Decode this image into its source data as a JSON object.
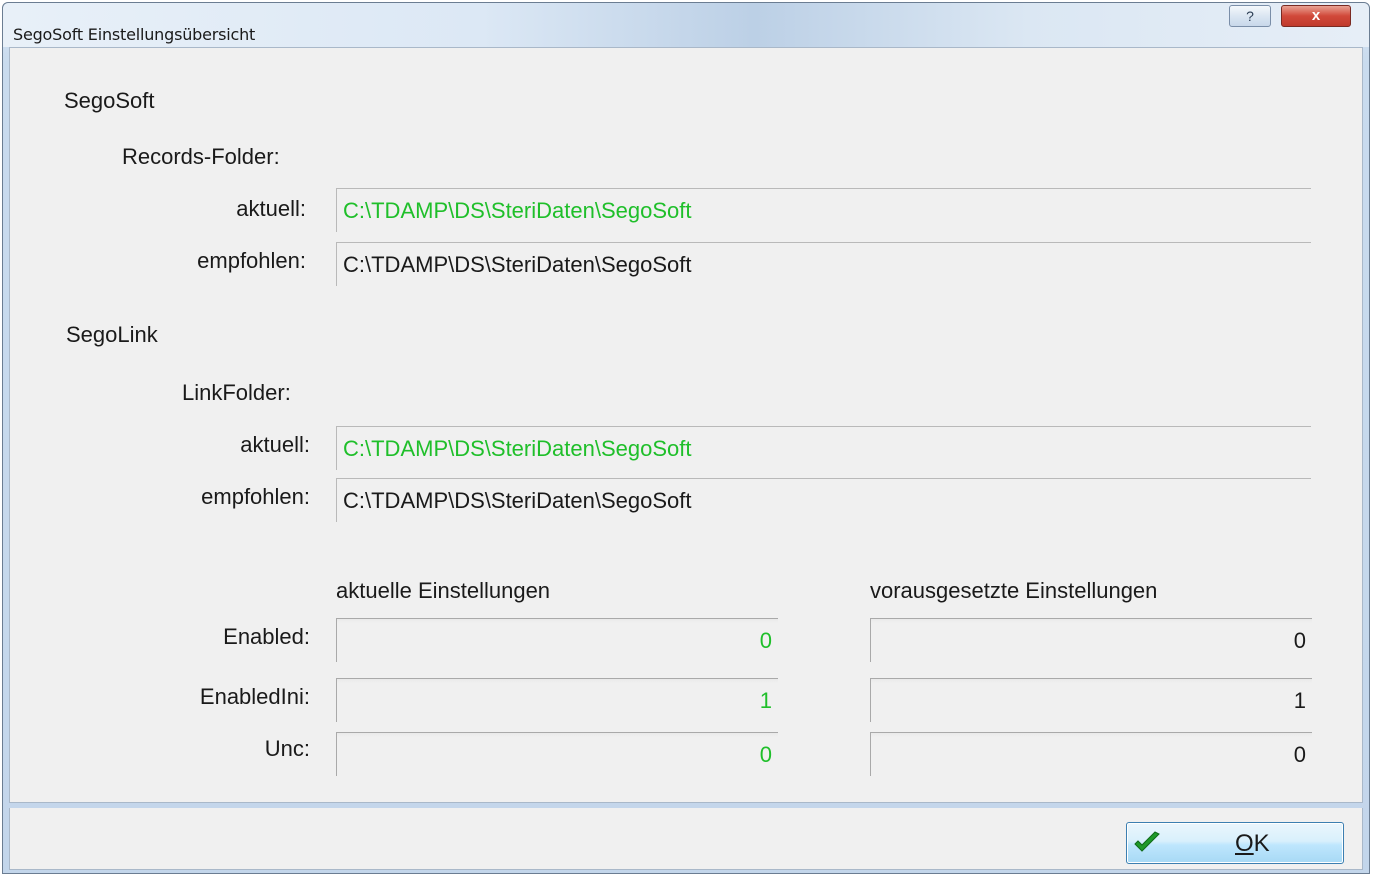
{
  "window": {
    "title": "SegoSoft Einstellungsübersicht",
    "help_glyph": "?",
    "close_glyph": "x"
  },
  "segosoft": {
    "heading": "SegoSoft",
    "records_folder_label": "Records-Folder:",
    "aktuell_label": "aktuell:",
    "aktuell_value": "C:\\TDAMP\\DS\\SteriDaten\\SegoSoft",
    "empfohlen_label": "empfohlen:",
    "empfohlen_value": "C:\\TDAMP\\DS\\SteriDaten\\SegoSoft"
  },
  "segolink": {
    "heading": "SegoLink",
    "link_folder_label": "LinkFolder:",
    "aktuell_label": "aktuell:",
    "aktuell_value": "C:\\TDAMP\\DS\\SteriDaten\\SegoSoft",
    "empfohlen_label": "empfohlen:",
    "empfohlen_value": "C:\\TDAMP\\DS\\SteriDaten\\SegoSoft"
  },
  "settings": {
    "current_header": "aktuelle Einstellungen",
    "required_header": "vorausgesetzte Einstellungen",
    "rows": [
      {
        "label": "Enabled:",
        "current": "0",
        "required": "0"
      },
      {
        "label": "EnabledIni:",
        "current": "1",
        "required": "1"
      },
      {
        "label": "Unc:",
        "current": "0",
        "required": "0"
      }
    ]
  },
  "footer": {
    "ok_mnemonic": "O",
    "ok_rest": "K"
  },
  "colors": {
    "match_green": "#1fbf2a",
    "text_dark": "#1a1a1a"
  }
}
